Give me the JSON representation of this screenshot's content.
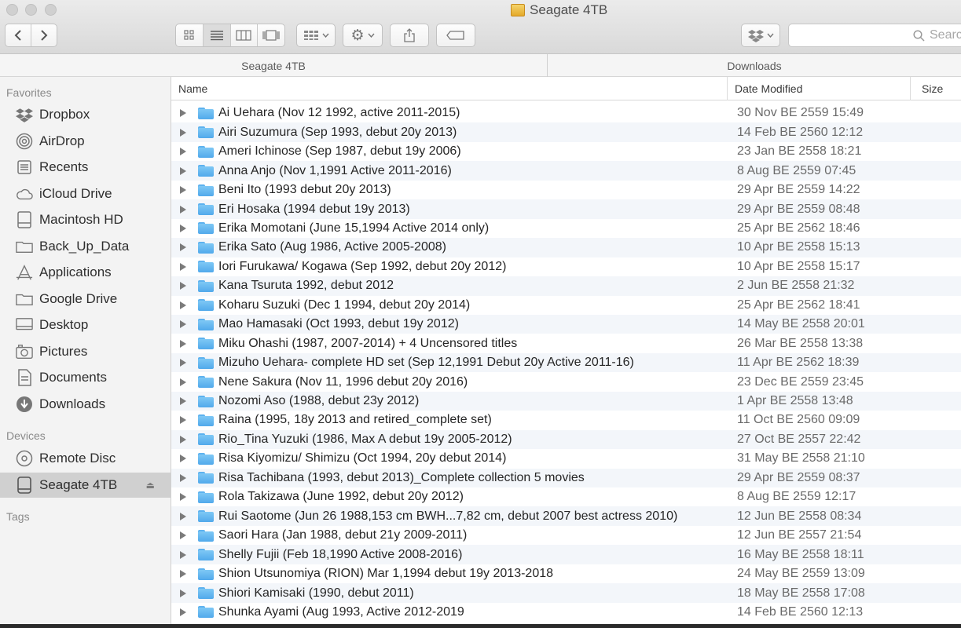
{
  "window": {
    "title": "Seagate 4TB"
  },
  "toolbar": {
    "search_placeholder": "Searc"
  },
  "pathbar": {
    "left": "Seagate 4TB",
    "right": "Downloads"
  },
  "sidebar": {
    "favorites_label": "Favorites",
    "favorites": [
      {
        "label": "Dropbox",
        "icon": "dropbox-icon"
      },
      {
        "label": "AirDrop",
        "icon": "airdrop-icon"
      },
      {
        "label": "Recents",
        "icon": "recents-icon"
      },
      {
        "label": "iCloud Drive",
        "icon": "cloud-icon"
      },
      {
        "label": "Macintosh HD",
        "icon": "hard-drive-icon"
      },
      {
        "label": "Back_Up_Data",
        "icon": "folder-icon"
      },
      {
        "label": "Applications",
        "icon": "applications-icon"
      },
      {
        "label": "Google Drive",
        "icon": "folder-icon"
      },
      {
        "label": "Desktop",
        "icon": "desktop-icon"
      },
      {
        "label": "Pictures",
        "icon": "camera-icon"
      },
      {
        "label": "Documents",
        "icon": "document-icon"
      },
      {
        "label": "Downloads",
        "icon": "download-icon"
      }
    ],
    "devices_label": "Devices",
    "devices": [
      {
        "label": "Remote Disc",
        "icon": "disc-icon"
      },
      {
        "label": "Seagate 4TB",
        "icon": "external-drive-icon",
        "selected": true
      }
    ],
    "tags_label": "Tags"
  },
  "columns": {
    "name": "Name",
    "date": "Date Modified",
    "size": "Size"
  },
  "files": [
    {
      "name": "Ai Uehara (Nov 12 1992, active 2011-2015)",
      "date": "30 Nov BE 2559 15:49"
    },
    {
      "name": "Airi Suzumura (Sep 1993, debut 20y 2013)",
      "date": "14 Feb BE 2560 12:12"
    },
    {
      "name": "Ameri Ichinose (Sep 1987, debut 19y 2006)",
      "date": "23 Jan BE 2558 18:21"
    },
    {
      "name": "Anna Anjo (Nov 1,1991 Active 2011-2016)",
      "date": "8 Aug BE 2559 07:45"
    },
    {
      "name": "Beni Ito (1993 debut 20y 2013)",
      "date": "29 Apr BE 2559 14:22"
    },
    {
      "name": "Eri Hosaka (1994 debut 19y 2013)",
      "date": "29 Apr BE 2559 08:48"
    },
    {
      "name": "Erika Momotani (June 15,1994 Active 2014 only)",
      "date": "25 Apr BE 2562 18:46"
    },
    {
      "name": "Erika Sato (Aug 1986, Active 2005-2008)",
      "date": "10 Apr BE 2558 15:13"
    },
    {
      "name": "Iori Furukawa/ Kogawa (Sep 1992, debut 20y 2012)",
      "date": "10 Apr BE 2558 15:17"
    },
    {
      "name": "Kana Tsuruta 1992, debut 2012",
      "date": "2 Jun BE 2558 21:32"
    },
    {
      "name": "Koharu Suzuki (Dec 1 1994, debut 20y 2014)",
      "date": "25 Apr BE 2562 18:41"
    },
    {
      "name": "Mao Hamasaki (Oct 1993, debut 19y 2012)",
      "date": "14 May BE 2558 20:01"
    },
    {
      "name": "Miku Ohashi (1987, 2007-2014) + 4 Uncensored titles",
      "date": "26 Mar BE 2558 13:38"
    },
    {
      "name": "Mizuho Uehara- complete HD set (Sep 12,1991 Debut 20y Active 2011-16)",
      "date": "11 Apr BE 2562 18:39"
    },
    {
      "name": "Nene Sakura (Nov 11, 1996 debut 20y 2016)",
      "date": "23 Dec BE 2559 23:45"
    },
    {
      "name": "Nozomi Aso (1988, debut 23y 2012)",
      "date": "1 Apr BE 2558 13:48"
    },
    {
      "name": "Raina (1995, 18y 2013 and retired_complete set)",
      "date": "11 Oct BE 2560 09:09"
    },
    {
      "name": "Rio_Tina Yuzuki (1986, Max A debut 19y 2005-2012)",
      "date": "27 Oct BE 2557 22:42"
    },
    {
      "name": "Risa Kiyomizu/ Shimizu (Oct 1994, 20y debut 2014)",
      "date": "31 May BE 2558 21:10"
    },
    {
      "name": "Risa Tachibana (1993, debut 2013)_Complete collection 5 movies",
      "date": "29 Apr BE 2559 08:37"
    },
    {
      "name": "Rola Takizawa (June 1992, debut 20y 2012)",
      "date": "8 Aug BE 2559 12:17"
    },
    {
      "name": "Rui Saotome (Jun 26 1988,153 cm BWH...7,82 cm, debut 2007 best actress 2010)",
      "date": "12 Jun BE 2558 08:34"
    },
    {
      "name": "Saori Hara (Jan 1988, debut 21y 2009-2011)",
      "date": "12 Jun BE 2557 21:54"
    },
    {
      "name": "Shelly Fujii (Feb 18,1990 Active 2008-2016)",
      "date": "16 May BE 2558 18:11"
    },
    {
      "name": "Shion Utsunomiya (RION) Mar 1,1994 debut 19y 2013-2018",
      "date": "24 May BE 2559 13:09"
    },
    {
      "name": "Shiori Kamisaki (1990, debut 2011)",
      "date": "18 May BE 2558 17:08"
    },
    {
      "name": "Shunka Ayami (Aug 1993, Active 2012-2019",
      "date": "14 Feb BE 2560 12:13"
    }
  ]
}
